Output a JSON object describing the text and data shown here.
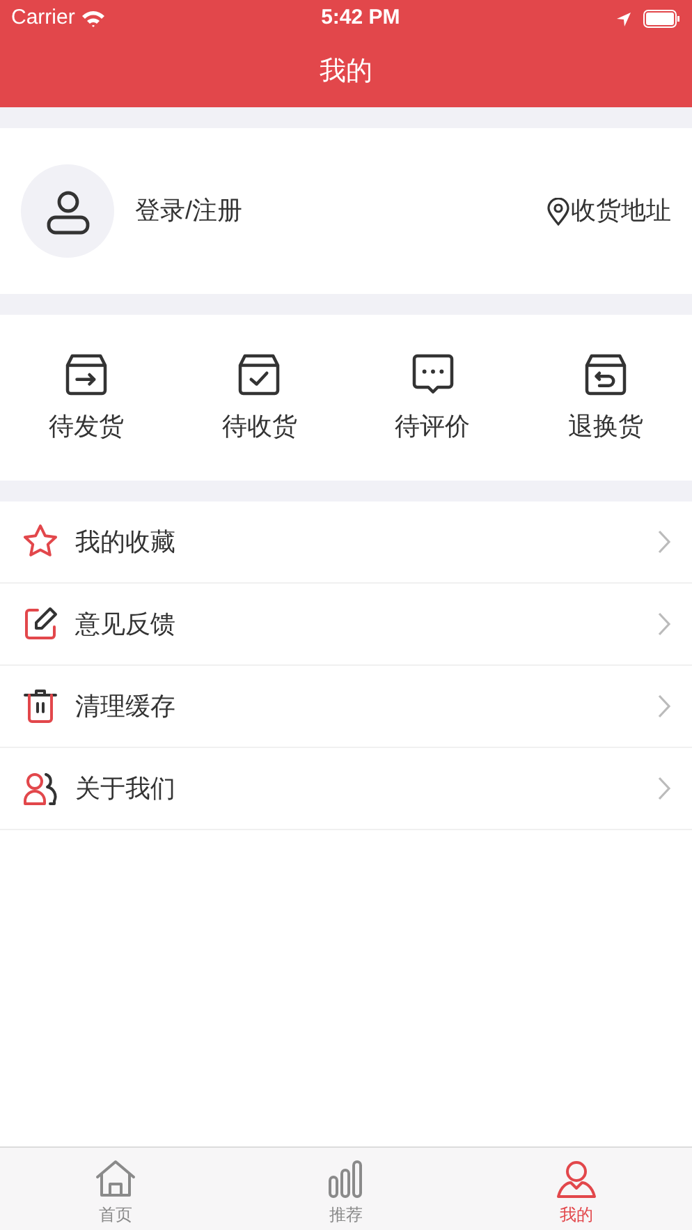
{
  "status_bar": {
    "carrier": "Carrier",
    "time": "5:42 PM"
  },
  "nav_bar": {
    "title": "我的"
  },
  "profile": {
    "login_label": "登录/注册",
    "address_label": "收货地址"
  },
  "orders": [
    {
      "kind": "ship",
      "label": "待发货"
    },
    {
      "kind": "receive",
      "label": "待收货"
    },
    {
      "kind": "review",
      "label": "待评价"
    },
    {
      "kind": "return",
      "label": "退换货"
    }
  ],
  "menu": [
    {
      "kind": "star",
      "label": "我的收藏"
    },
    {
      "kind": "edit",
      "label": "意见反馈"
    },
    {
      "kind": "trash",
      "label": "清理缓存"
    },
    {
      "kind": "people",
      "label": "关于我们"
    }
  ],
  "tab_bar": [
    {
      "kind": "home",
      "label": "首页",
      "selected": false
    },
    {
      "kind": "bars",
      "label": "推荐",
      "selected": false
    },
    {
      "kind": "user",
      "label": "我的",
      "selected": true
    }
  ]
}
